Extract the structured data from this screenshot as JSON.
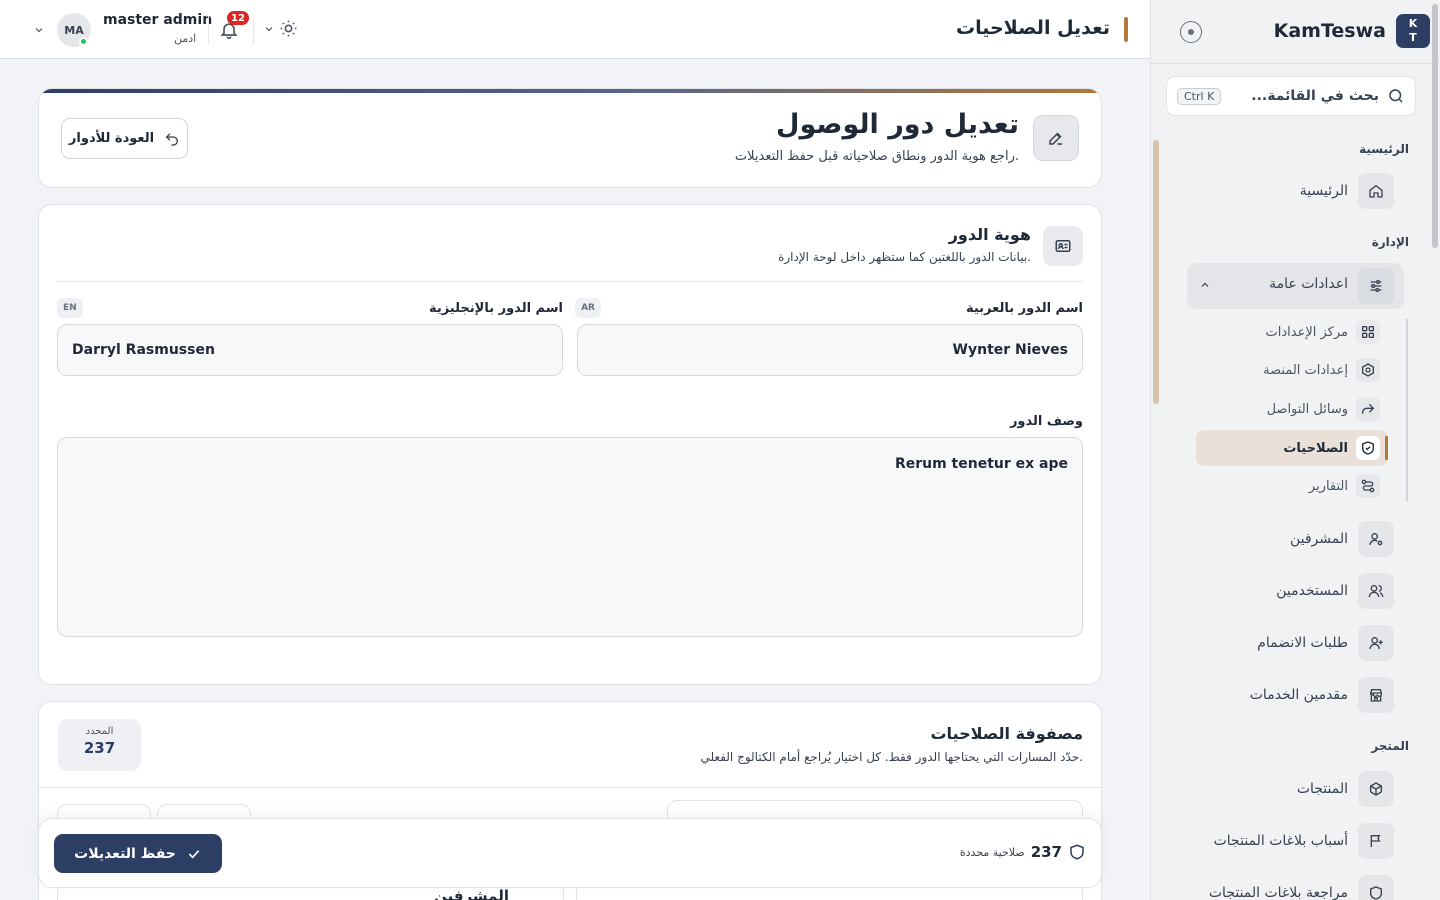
{
  "sidebar": {
    "brand_initials_top": "K",
    "brand_initials_bottom": "T",
    "brand_name": "KamTeswa",
    "search_placeholder": "بحث في القائمة...",
    "search_shortcut": "Ctrl K",
    "sections": {
      "home": "الرئيسية",
      "admin": "الإدارة",
      "store": "المتجر"
    },
    "items": {
      "home": "الرئيسية",
      "general_settings": "اعدادات عامة",
      "supervisors": "المشرفين",
      "users": "المستخدمين",
      "join_requests": "طلبات الانضمام",
      "service_providers": "مقدمين الخدمات",
      "products": "المنتجات",
      "report_reasons": "أسباب بلاغات المنتجات",
      "report_review": "مراجعة بلاغات المنتجات"
    },
    "sub_items": {
      "settings_center": "مركز الإعدادات",
      "platform_settings": "إعدادات المنصة",
      "social_media": "وسائل التواصل",
      "permissions": "الصلاحيات",
      "reports": "التقارير"
    }
  },
  "topbar": {
    "title": "تعديل الصلاحيات",
    "user_name": "master admin",
    "user_role": "ادمن",
    "avatar_initials": "MA",
    "notification_count": "12"
  },
  "header": {
    "title": "تعديل دور الوصول",
    "subtitle": "راجع هوية الدور ونطاق صلاحياته قبل حفظ التعديلات.",
    "back_label": "العودة للأدوار"
  },
  "identity": {
    "title": "هوية الدور",
    "subtitle": "بيانات الدور باللغتين كما ستظهر داخل لوحة الإدارة.",
    "name_ar_label": "اسم الدور بالعربية",
    "name_ar_tag": "AR",
    "name_ar_value": "Wynter Nieves",
    "name_en_label": "اسم الدور بالإنجليزية",
    "name_en_tag": "EN",
    "name_en_value": "Darryl Rasmussen",
    "description_label": "وصف الدور",
    "description_value": "Rerum tenetur ex ape"
  },
  "matrix": {
    "title": "مصفوفة الصلاحيات",
    "subtitle": "حدّد المسارات التي يحتاجها الدور فقط. كل اختيار يُراجع أمام الكتالوج الفعلي.",
    "selected_label": "المحدد",
    "selected_value": "237",
    "group_label": "المشرفين"
  },
  "save_bar": {
    "selected_count": "237",
    "selected_text": "صلاحية محددة",
    "save_label": "حفظ التعديلات"
  },
  "colors": {
    "primary": "#2c3e63",
    "accent": "#b2773a",
    "notification": "#dc2626",
    "online": "#22c55e"
  }
}
